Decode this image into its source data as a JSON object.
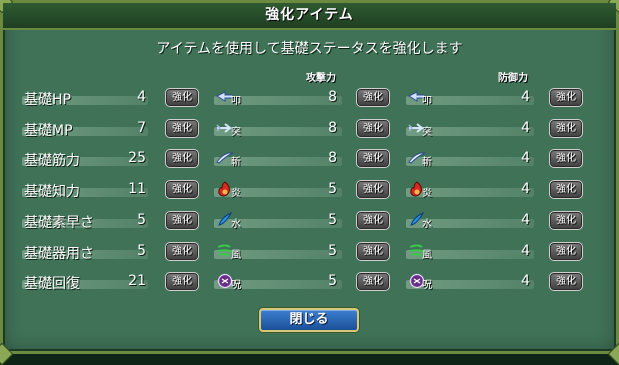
{
  "window": {
    "title": "強化アイテム",
    "subtitle": "アイテムを使用して基礎ステータスを強化します",
    "close_label": "閉じる"
  },
  "columns": {
    "attack": "攻撃力",
    "defense": "防御力"
  },
  "button_label": "強化",
  "rows": [
    {
      "label": "基礎HP",
      "value": "4",
      "element": "叩",
      "icon": "hammer-icon",
      "attack": "8",
      "defense": "4"
    },
    {
      "label": "基礎MP",
      "value": "7",
      "element": "突",
      "icon": "arrow-icon",
      "attack": "8",
      "defense": "4"
    },
    {
      "label": "基礎筋力",
      "value": "25",
      "element": "斬",
      "icon": "blade-icon",
      "attack": "8",
      "defense": "4"
    },
    {
      "label": "基礎知力",
      "value": "11",
      "element": "炎",
      "icon": "fire-icon",
      "attack": "5",
      "defense": "4"
    },
    {
      "label": "基礎素早さ",
      "value": "5",
      "element": "水",
      "icon": "water-icon",
      "attack": "5",
      "defense": "4"
    },
    {
      "label": "基礎器用さ",
      "value": "5",
      "element": "風",
      "icon": "wind-icon",
      "attack": "5",
      "defense": "4"
    },
    {
      "label": "基礎回復",
      "value": "21",
      "element": "呪",
      "icon": "curse-icon",
      "attack": "5",
      "defense": "4"
    }
  ],
  "colors": {
    "panel": "#3f7257",
    "border": "#6b8a40",
    "close_button": "#2a66b8"
  }
}
